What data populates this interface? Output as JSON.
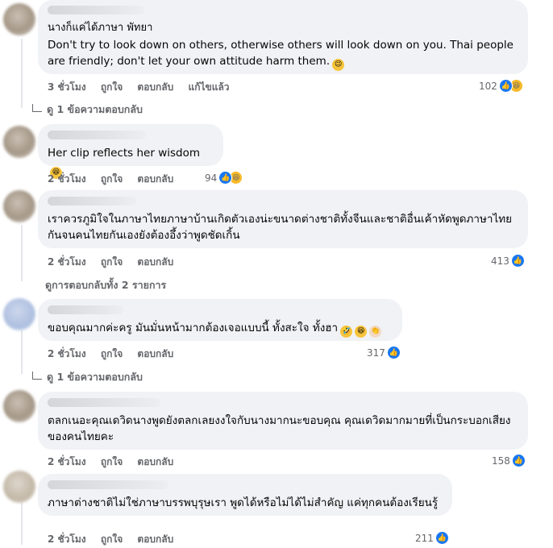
{
  "comments": [
    {
      "author": "นางก็แค่ได้ภาษา พัทยา",
      "text": "Don't try to look down on others, otherwise others will look down on you. Thai people are friendly; don't let your own attitude harm them.",
      "emoji": "wink-emoji",
      "time": "3 ชั่วโมง",
      "like": "ถูกใจ",
      "reply": "ตอบกลับ",
      "edited": "แก้ไขแล้ว",
      "reaction_count": "102",
      "reactions": [
        "like-icon",
        "haha-icon"
      ],
      "replies_label": "ดู 1 ข้อความตอบกลับ"
    },
    {
      "text": "Her clip reflects her wisdom",
      "emoji": "laugh-emoji",
      "time": "2 ชั่วโมง",
      "like": "ถูกใจ",
      "reply": "ตอบกลับ",
      "reaction_count": "94",
      "reactions": [
        "like-icon",
        "haha-icon"
      ]
    },
    {
      "text": "เราควรภูมิใจในภาษาไทยภาษาบ้านเกิดตัวเองน่ะขนาดต่างชาติทั้งจีนและชาติอื่นเค้าหัดพูดภาษาไทยกันจนคนไทยกันเองยังต้องอึ้งว่าพูดชัดเกิ้น",
      "time": "2 ชั่วโมง",
      "like": "ถูกใจ",
      "reply": "ตอบกลับ",
      "reaction_count": "413",
      "reactions": [
        "like-icon"
      ],
      "replies_label": "ดูการตอบกลับทั้ง 2 รายการ"
    },
    {
      "text": "ขอบคุณมากค่ะครู มันมั่นหน้ามากต้องเจอแบบนี้ ทั้งสะใจ ทั้งฮา",
      "emojis": [
        "rofl-emoji",
        "laugh-emoji",
        "clap-emoji"
      ],
      "time": "2 ชั่วโมง",
      "like": "ถูกใจ",
      "reply": "ตอบกลับ",
      "reaction_count": "317",
      "reactions": [
        "like-icon"
      ],
      "replies_label": "ดู 1 ข้อความตอบกลับ"
    },
    {
      "text": "ตลกเนอะคุณเดวิดนางพูดยังตลกเลยงงใจกับนางมากนะขอบคุณ คุณเดวิดมากมายที่เป็นกระบอกเสียงของคนไทยคะ",
      "time": "2 ชั่วโมง",
      "like": "ถูกใจ",
      "reply": "ตอบกลับ",
      "reaction_count": "158",
      "reactions": [
        "like-icon"
      ]
    },
    {
      "text": "ภาษาต่างชาติไม่ใช่ภาษาบรรพบุรุษเรา พูดได้หรือไม่ได้ไม่สำคัญ แค่ทุกคนต้องเรียนรู้",
      "time": "2 ชั่วโมง",
      "like": "ถูกใจ",
      "reply": "ตอบกลับ",
      "reaction_count": "211",
      "reactions": [
        "like-icon"
      ]
    }
  ],
  "colors": {
    "bubble": "#f0f2f5",
    "secondary_text": "#65676b",
    "like_blue": "#1877f2",
    "haha_yellow": "#f7b928"
  }
}
